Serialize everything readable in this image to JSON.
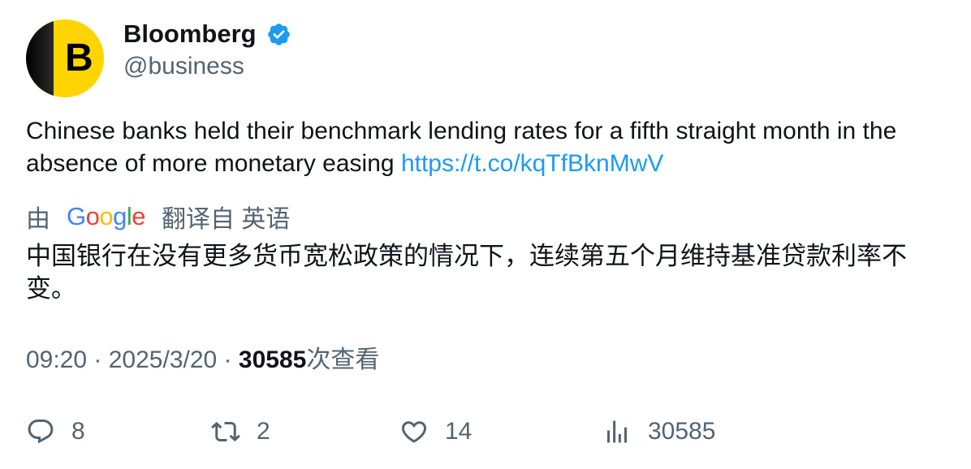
{
  "author": {
    "avatar_letter": "B",
    "name": "Bloomberg",
    "handle": "@business",
    "verified_color": "#1d9bf0",
    "avatar_color": "#ffd400"
  },
  "tweet": {
    "text": "Chinese banks held their benchmark lending rates for a fifth straight month in the absence of more monetary easing ",
    "link": "https://t.co/kqTfBknMwV",
    "link_color": "#1d9bf0"
  },
  "translation": {
    "prefix": "由",
    "provider": "Google",
    "suffix": "翻译自 英语",
    "text": "中国银行在没有更多货币宽松政策的情况下，连续第五个月维持基准贷款利率不变。"
  },
  "meta": {
    "time": "09:20",
    "separator": " · ",
    "date": "2025/3/20",
    "views": "30585",
    "views_label": "次查看"
  },
  "actions": {
    "reply_count": "8",
    "retweet_count": "2",
    "like_count": "14",
    "views_count": "30585",
    "icons": [
      "reply-icon",
      "retweet-icon",
      "like-icon",
      "analytics-icon"
    ]
  }
}
